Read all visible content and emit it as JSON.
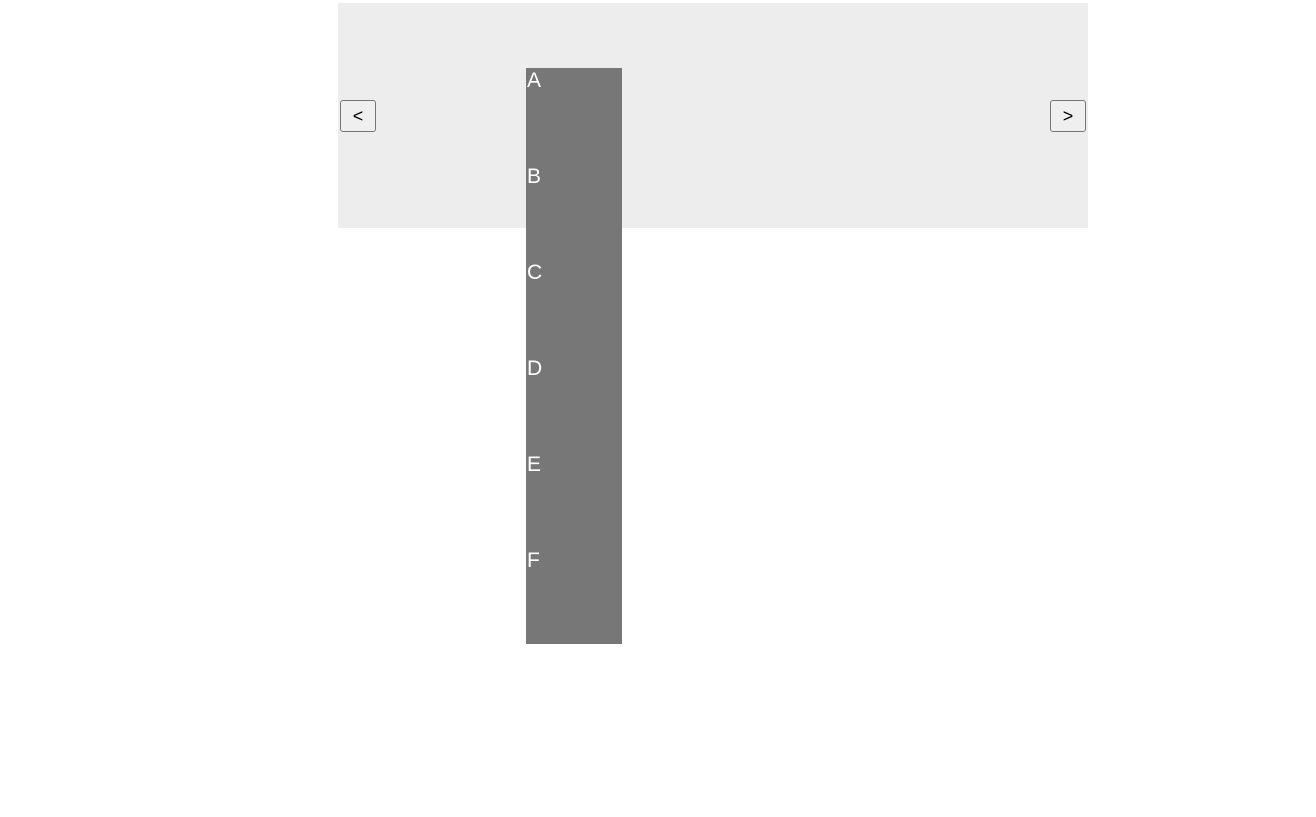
{
  "nav": {
    "prev_label": "<",
    "next_label": ">"
  },
  "items": [
    {
      "label": "A"
    },
    {
      "label": "B"
    },
    {
      "label": "C"
    },
    {
      "label": "D"
    },
    {
      "label": "E"
    },
    {
      "label": "F"
    }
  ]
}
